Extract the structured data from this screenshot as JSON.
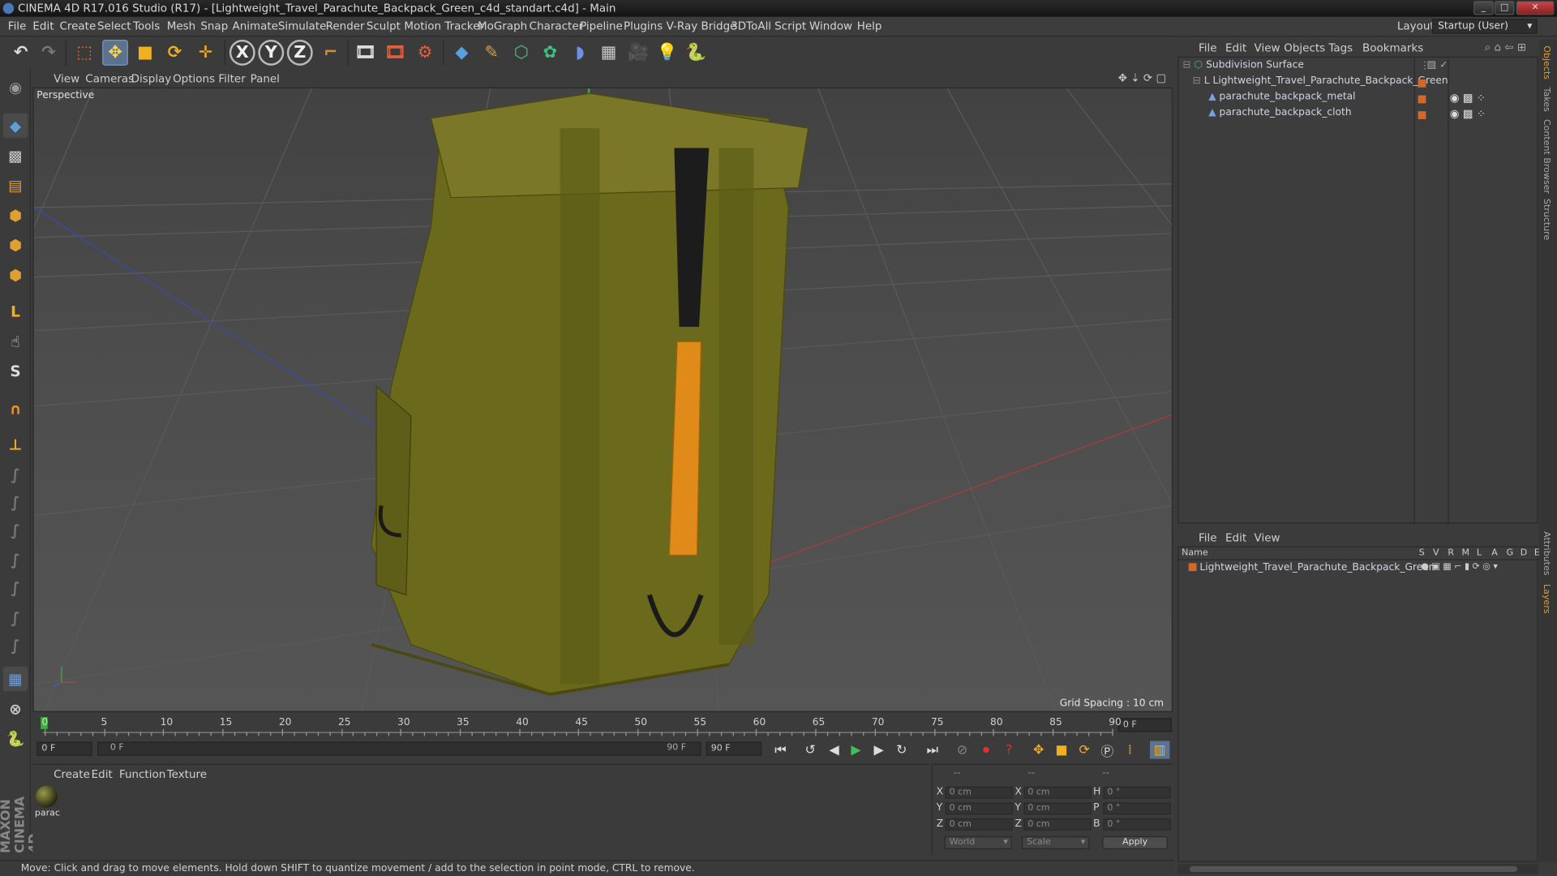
{
  "window": {
    "title": "CINEMA 4D R17.016 Studio (R17) - [Lightweight_Travel_Parachute_Backpack_Green_c4d_standart.c4d] - Main"
  },
  "menubar": {
    "items": [
      "File",
      "Edit",
      "Create",
      "Select",
      "Tools",
      "Mesh",
      "Snap",
      "Animate",
      "Simulate",
      "Render",
      "Sculpt",
      "Motion Tracker",
      "MoGraph",
      "Character",
      "Pipeline",
      "Plugins",
      "V-Ray Bridge",
      "3DToAll",
      "Script",
      "Window",
      "Help"
    ],
    "layout_label": "Layout:",
    "layout_value": "Startup (User)"
  },
  "viewport": {
    "menu": [
      "View",
      "Cameras",
      "Display",
      "Options",
      "Filter",
      "Panel"
    ],
    "label": "Perspective",
    "grid_spacing": "Grid Spacing : 10 cm"
  },
  "timeline": {
    "ticks": [
      "0",
      "5",
      "10",
      "15",
      "20",
      "25",
      "30",
      "35",
      "40",
      "45",
      "50",
      "55",
      "60",
      "65",
      "70",
      "75",
      "80",
      "85",
      "90"
    ],
    "end_field": "0 F",
    "start_frame": "0 F",
    "range_start": "0 F",
    "range_end": "90 F",
    "max_frame": "90 F"
  },
  "material_panel": {
    "menu": [
      "Create",
      "Edit",
      "Function",
      "Texture"
    ],
    "materials": [
      {
        "name": "parac"
      }
    ]
  },
  "coords": {
    "header": [
      "--",
      "--",
      "--"
    ],
    "rows": [
      {
        "a": "X",
        "av": "0 cm",
        "b": "X",
        "bv": "0 cm",
        "c": "H",
        "cv": "0 °"
      },
      {
        "a": "Y",
        "av": "0 cm",
        "b": "Y",
        "bv": "0 cm",
        "c": "P",
        "cv": "0 °"
      },
      {
        "a": "Z",
        "av": "0 cm",
        "b": "Z",
        "bv": "0 cm",
        "c": "B",
        "cv": "0 °"
      }
    ],
    "world": "World",
    "scale": "Scale",
    "apply": "Apply"
  },
  "status": "Move: Click and drag to move elements. Hold down SHIFT to quantize movement / add to the selection in point mode, CTRL to remove.",
  "object_manager": {
    "menu": [
      "File",
      "Edit",
      "View",
      "Objects",
      "Tags",
      "Bookmarks"
    ],
    "objects": [
      {
        "name": "Subdivision Surface"
      },
      {
        "name": "Lightweight_Travel_Parachute_Backpack_Green"
      },
      {
        "name": "parachute_backpack_metal"
      },
      {
        "name": "parachute_backpack_cloth"
      }
    ]
  },
  "layer_manager": {
    "menu": [
      "File",
      "Edit",
      "View"
    ],
    "columns": [
      "Name",
      "S",
      "V",
      "R",
      "M",
      "L",
      "A",
      "G",
      "D",
      "E"
    ],
    "layers": [
      {
        "name": "Lightweight_Travel_Parachute_Backpack_Green"
      }
    ]
  },
  "side_tabs": [
    "Objects",
    "Takes",
    "Content Browser",
    "Structure",
    "Attributes",
    "Layers"
  ],
  "colors": {
    "accent": "#5b7391",
    "layer_orange": "#d2682a",
    "backpack": "#6b6a1c",
    "strap_orange": "#e08a1a"
  }
}
